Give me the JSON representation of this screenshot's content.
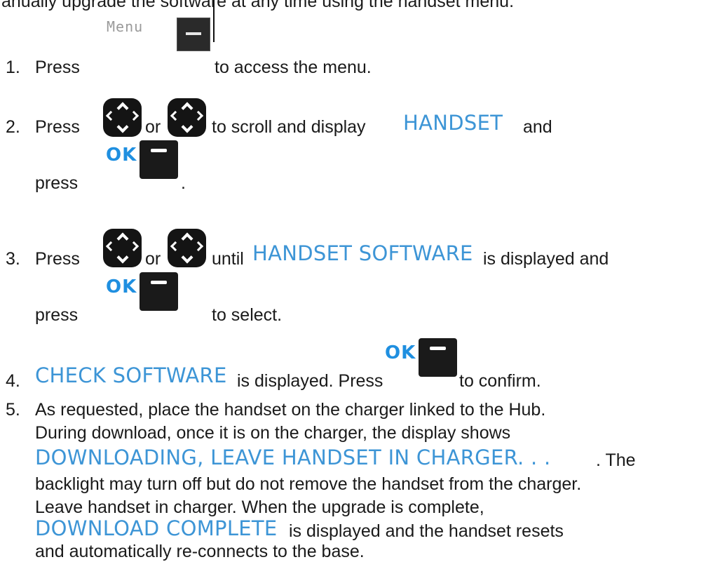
{
  "intro": "anually upgrade the software at any time using the handset menu.",
  "keys": {
    "menu": "Menu",
    "ok": "OK"
  },
  "step1": {
    "num": "1.",
    "press": "Press",
    "after": "to access the menu."
  },
  "step2": {
    "num": "2.",
    "press": "Press",
    "or": "or",
    "after": "to scroll and display",
    "display": "HANDSET",
    "and": "and",
    "press2": "press",
    "end": "."
  },
  "step3": {
    "num": "3.",
    "press": "Press",
    "or": "or",
    "after": "until",
    "display": "HANDSET SOFTWARE",
    "tail": "is displayed and",
    "press2": "press",
    "end": "to select."
  },
  "step4": {
    "num": "4.",
    "display": "CHECK SOFTWARE",
    "mid": "is displayed.  Press",
    "end": "to confirm."
  },
  "step5": {
    "num": "5.",
    "line1": "As requested, place the handset on the charger linked to the Hub.",
    "line2": "During download, once it is on the charger, the display shows",
    "display1": "DOWNLOADING, LEAVE HANDSET IN CHARGER. . .",
    "line3_tail": ". The",
    "line4": "backlight may turn off but do not remove the handset from the charger.",
    "line5": "Leave handset in charger.  When the upgrade is complete,",
    "display2": "DOWNLOAD COMPLETE",
    "line6_tail": "is displayed and the handset resets",
    "line7": "and automatically re-connects to the base."
  }
}
